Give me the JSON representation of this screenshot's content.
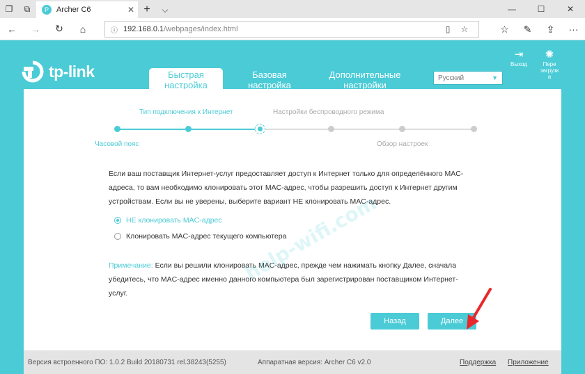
{
  "browser": {
    "tab_title": "Archer C6",
    "url_main": "192.168.0.1",
    "url_rest": "/webpages/index.html"
  },
  "header": {
    "brand": "tp-link",
    "tabs": [
      {
        "line1": "Быстрая",
        "line2": "настройка"
      },
      {
        "line1": "Базовая",
        "line2": "настройка"
      },
      {
        "line1": "Дополнительные",
        "line2": "настройки"
      }
    ],
    "language": "Русский",
    "logout_label": "Выход",
    "reboot_label_1": "Пере",
    "reboot_label_2": "загрузк",
    "reboot_label_3": "а"
  },
  "steps": {
    "top": [
      "Тип подключения к Интернет",
      "Настройки беспроводного режима"
    ],
    "bottom": [
      "Часовой пояс",
      "Обзор настроек"
    ]
  },
  "content": {
    "description": "Если ваш поставщик Интернет-услуг предоставляет доступ к Интернет только для определённого MAC-адреса, то вам необходимо клонировать этот MAC-адрес, чтобы разрешить доступ к Интернет другим устройствам. Если вы не уверены, выберите вариант НЕ клонировать MAC-адрес.",
    "option_no_clone": "НЕ клонировать MAC-адрес",
    "option_clone": "Клонировать MAC-адрес текущего компьютера",
    "note_label": "Примечание:",
    "note_text": "Если вы решили клонировать MAC-адрес, прежде чем нажимать кнопку Далее, сначала убедитесь, что MAC-адрес именно данного компьютера был зарегистрирован поставщиком Интернет-услуг.",
    "back_label": "Назад",
    "next_label": "Далее"
  },
  "watermark": "help-wifi.com",
  "footer": {
    "firmware": "Версия встроенного ПО: 1.0.2 Build 20180731 rel.38243(5255)",
    "hardware": "Аппаратная версия: Archer C6 v2.0",
    "support": "Поддержка",
    "app": "Приложение"
  },
  "colors": {
    "accent": "#4acbd6",
    "arrow": "#e8282b"
  }
}
